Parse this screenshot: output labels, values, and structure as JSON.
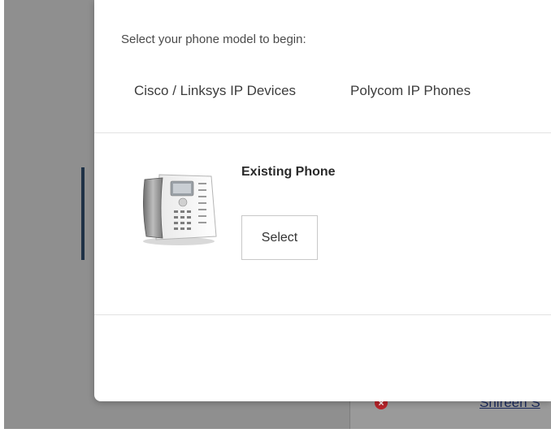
{
  "background": {
    "error_icon_glyph": "×",
    "user_link_text": "Shireen S"
  },
  "modal": {
    "intro_text": "Select your phone model to begin:",
    "tabs": [
      {
        "label": "Cisco / Linksys IP Devices"
      },
      {
        "label": "Polycom IP Phones"
      }
    ],
    "phone": {
      "title": "Existing Phone",
      "select_label": "Select",
      "icon": "desk-phone-icon"
    }
  },
  "colors": {
    "backdrop": "#8f8f8f",
    "accent_bar": "#1f3247",
    "error_red": "#b8242a",
    "link_blue": "#1b2a5c"
  }
}
